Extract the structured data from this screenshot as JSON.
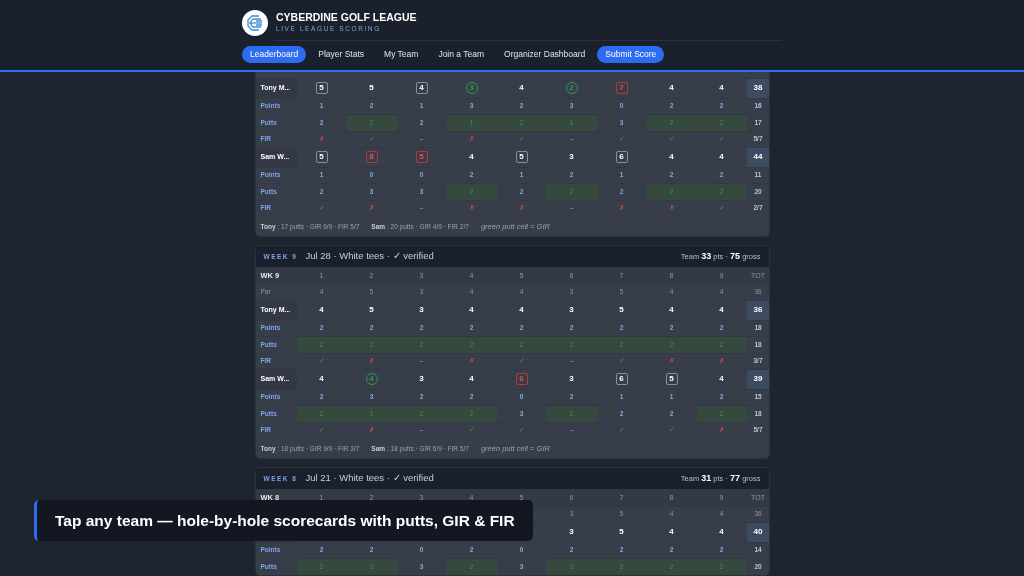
{
  "brand": {
    "title": "CYBERDINE GOLF LEAGUE",
    "subtitle": "LIVE LEAGUE SCORING"
  },
  "nav": [
    {
      "label": "Leaderboard",
      "kind": "tab",
      "selected": true
    },
    {
      "label": "Player Stats",
      "kind": "tab",
      "selected": false
    },
    {
      "label": "My Team",
      "kind": "tab",
      "selected": false
    },
    {
      "label": "Join a Team",
      "kind": "tab",
      "selected": false
    },
    {
      "label": "Organizer Dashboard",
      "kind": "tab",
      "selected": false
    },
    {
      "label": "Submit Score",
      "kind": "cta"
    }
  ],
  "cards": [
    {
      "players": [
        {
          "name": "Tony M...",
          "scores": [
            {
              "value": "5",
              "kind": "bogey"
            },
            {
              "value": "5",
              "kind": "par"
            },
            {
              "value": "4",
              "kind": "bogey"
            },
            {
              "value": "3",
              "kind": "birdie"
            },
            {
              "value": "4",
              "kind": "par"
            },
            {
              "value": "2",
              "kind": "birdie"
            },
            {
              "value": "7",
              "kind": "double"
            },
            {
              "value": "4",
              "kind": "par"
            },
            {
              "value": "4",
              "kind": "par"
            }
          ],
          "total": "38",
          "points_label": "Points",
          "points": [
            "1",
            "2",
            "1",
            "3",
            "2",
            "3",
            "0",
            "2",
            "2"
          ],
          "points_total": "16",
          "putts_label": "Putts",
          "putts": [
            {
              "value": "2",
              "gir": false
            },
            {
              "value": "2",
              "gir": true
            },
            {
              "value": "2",
              "gir": false
            },
            {
              "value": "1",
              "gir": true
            },
            {
              "value": "2",
              "gir": true
            },
            {
              "value": "1",
              "gir": true
            },
            {
              "value": "3",
              "gir": false
            },
            {
              "value": "2",
              "gir": true
            },
            {
              "value": "2",
              "gir": true
            }
          ],
          "putts_total": "17",
          "fir_label": "FIR",
          "fir": [
            {
              "text": "✗",
              "kind": "miss"
            },
            {
              "text": "✓",
              "kind": "hit"
            },
            {
              "text": "–",
              "kind": "na"
            },
            {
              "text": "✗",
              "kind": "miss"
            },
            {
              "text": "✓",
              "kind": "hit"
            },
            {
              "text": "–",
              "kind": "na"
            },
            {
              "text": "✓",
              "kind": "hit"
            },
            {
              "text": "✓",
              "kind": "hit"
            },
            {
              "text": "✓",
              "kind": "hit"
            }
          ],
          "fir_total": "5/7"
        },
        {
          "name": "Sam W...",
          "scores": [
            {
              "value": "5",
              "kind": "bogey"
            },
            {
              "value": "8",
              "kind": "double"
            },
            {
              "value": "5",
              "kind": "double"
            },
            {
              "value": "4",
              "kind": "par"
            },
            {
              "value": "5",
              "kind": "bogey"
            },
            {
              "value": "3",
              "kind": "par"
            },
            {
              "value": "6",
              "kind": "bogey"
            },
            {
              "value": "4",
              "kind": "par"
            },
            {
              "value": "4",
              "kind": "par"
            }
          ],
          "total": "44",
          "points_label": "Points",
          "points": [
            "1",
            "0",
            "0",
            "2",
            "1",
            "2",
            "1",
            "2",
            "2"
          ],
          "points_total": "11",
          "putts_label": "Putts",
          "putts": [
            {
              "value": "2",
              "gir": false
            },
            {
              "value": "3",
              "gir": false
            },
            {
              "value": "3",
              "gir": false
            },
            {
              "value": "2",
              "gir": true
            },
            {
              "value": "2",
              "gir": false
            },
            {
              "value": "2",
              "gir": true
            },
            {
              "value": "2",
              "gir": false
            },
            {
              "value": "2",
              "gir": true
            },
            {
              "value": "2",
              "gir": true
            }
          ],
          "putts_total": "20",
          "fir_label": "FIR",
          "fir": [
            {
              "text": "✓",
              "kind": "hit"
            },
            {
              "text": "✗",
              "kind": "miss"
            },
            {
              "text": "–",
              "kind": "na"
            },
            {
              "text": "✗",
              "kind": "miss"
            },
            {
              "text": "✗",
              "kind": "miss"
            },
            {
              "text": "–",
              "kind": "na"
            },
            {
              "text": "✗",
              "kind": "miss"
            },
            {
              "text": "✗",
              "kind": "miss"
            },
            {
              "text": "✓",
              "kind": "hit"
            }
          ],
          "fir_total": "2/7"
        }
      ],
      "summaries": [
        "**Tony** : 17 putts · GIR 6/9 · FIR 5/7",
        "**Sam** : 20 putts · GIR 4/9 · FIR 2/7"
      ],
      "note": "green putt cell = GIR"
    },
    {
      "week": "WEEK 9",
      "title": "Jul 28 · White tees · ✓ verified",
      "team": "Team **33** pts · **75** gross",
      "head": {
        "label": "WK 9",
        "holes": [
          "1",
          "2",
          "3",
          "4",
          "5",
          "6",
          "7",
          "8",
          "9"
        ],
        "total": "TOT"
      },
      "par": {
        "label": "Par",
        "values": [
          "4",
          "5",
          "3",
          "4",
          "4",
          "3",
          "5",
          "4",
          "4"
        ],
        "total": "36"
      },
      "players": [
        {
          "name": "Tony M...",
          "scores": [
            {
              "value": "4",
              "kind": "par"
            },
            {
              "value": "5",
              "kind": "par"
            },
            {
              "value": "3",
              "kind": "par"
            },
            {
              "value": "4",
              "kind": "par"
            },
            {
              "value": "4",
              "kind": "par"
            },
            {
              "value": "3",
              "kind": "par"
            },
            {
              "value": "5",
              "kind": "par"
            },
            {
              "value": "4",
              "kind": "par"
            },
            {
              "value": "4",
              "kind": "par"
            }
          ],
          "total": "36",
          "points_label": "Points",
          "points": [
            "2",
            "2",
            "2",
            "2",
            "2",
            "2",
            "2",
            "2",
            "2"
          ],
          "points_total": "18",
          "putts_label": "Putts",
          "putts": [
            {
              "value": "2",
              "gir": true
            },
            {
              "value": "2",
              "gir": true
            },
            {
              "value": "2",
              "gir": true
            },
            {
              "value": "2",
              "gir": true
            },
            {
              "value": "2",
              "gir": true
            },
            {
              "value": "2",
              "gir": true
            },
            {
              "value": "2",
              "gir": true
            },
            {
              "value": "2",
              "gir": true
            },
            {
              "value": "2",
              "gir": true
            }
          ],
          "putts_total": "18",
          "fir_label": "FIR",
          "fir": [
            {
              "text": "✓",
              "kind": "hit"
            },
            {
              "text": "✗",
              "kind": "miss"
            },
            {
              "text": "–",
              "kind": "na"
            },
            {
              "text": "✗",
              "kind": "miss"
            },
            {
              "text": "✓",
              "kind": "hit"
            },
            {
              "text": "–",
              "kind": "na"
            },
            {
              "text": "✓",
              "kind": "hit"
            },
            {
              "text": "✗",
              "kind": "miss"
            },
            {
              "text": "✗",
              "kind": "miss"
            }
          ],
          "fir_total": "3/7"
        },
        {
          "name": "Sam W...",
          "scores": [
            {
              "value": "4",
              "kind": "par"
            },
            {
              "value": "4",
              "kind": "birdie"
            },
            {
              "value": "3",
              "kind": "par"
            },
            {
              "value": "4",
              "kind": "par"
            },
            {
              "value": "6",
              "kind": "double"
            },
            {
              "value": "3",
              "kind": "par"
            },
            {
              "value": "6",
              "kind": "bogey"
            },
            {
              "value": "5",
              "kind": "bogey"
            },
            {
              "value": "4",
              "kind": "par"
            }
          ],
          "total": "39",
          "points_label": "Points",
          "points": [
            "2",
            "3",
            "2",
            "2",
            "0",
            "2",
            "1",
            "1",
            "2"
          ],
          "points_total": "15",
          "putts_label": "Putts",
          "putts": [
            {
              "value": "2",
              "gir": true
            },
            {
              "value": "1",
              "gir": true
            },
            {
              "value": "2",
              "gir": true
            },
            {
              "value": "2",
              "gir": true
            },
            {
              "value": "3",
              "gir": false
            },
            {
              "value": "2",
              "gir": true
            },
            {
              "value": "2",
              "gir": false
            },
            {
              "value": "2",
              "gir": false
            },
            {
              "value": "2",
              "gir": true
            }
          ],
          "putts_total": "18",
          "fir_label": "FIR",
          "fir": [
            {
              "text": "✓",
              "kind": "hit"
            },
            {
              "text": "✗",
              "kind": "miss"
            },
            {
              "text": "–",
              "kind": "na"
            },
            {
              "text": "✓",
              "kind": "hit"
            },
            {
              "text": "✓",
              "kind": "hit"
            },
            {
              "text": "–",
              "kind": "na"
            },
            {
              "text": "✓",
              "kind": "hit"
            },
            {
              "text": "✓",
              "kind": "hit"
            },
            {
              "text": "✗",
              "kind": "miss"
            }
          ],
          "fir_total": "5/7"
        }
      ],
      "summaries": [
        "**Tony** : 18 putts · GIR 9/9 · FIR 3/7",
        "**Sam** : 18 putts · GIR 6/9 · FIR 5/7"
      ],
      "note": "green putt cell = GIR"
    },
    {
      "week": "WEEK 8",
      "title": "Jul 21 · White tees · ✓ verified",
      "team": "Team **31** pts · **77** gross",
      "head": {
        "label": "WK 8",
        "holes": [
          "1",
          "2",
          "3",
          "4",
          "5",
          "6",
          "7",
          "8",
          "9"
        ],
        "total": "TOT"
      },
      "par": {
        "values": [
          "3",
          "5",
          "4",
          "4"
        ],
        "total": "36"
      },
      "players": [
        {
          "scores": [
            {
              "value": "3",
              "kind": "par"
            },
            {
              "value": "5",
              "kind": "par"
            },
            {
              "value": "4",
              "kind": "par"
            },
            {
              "value": "4",
              "kind": "par"
            }
          ],
          "total": "40",
          "points_label": "Points",
          "points": [
            "2",
            "2",
            "0",
            "2",
            "0",
            "2",
            "2",
            "2",
            "2"
          ],
          "points_total": "14",
          "putts_label": "Putts",
          "putts": [
            {
              "value": "2",
              "gir": true
            },
            {
              "value": "2",
              "gir": true
            },
            {
              "value": "3",
              "gir": false
            },
            {
              "value": "2",
              "gir": true
            },
            {
              "value": "3",
              "gir": false
            },
            {
              "value": "2",
              "gir": true
            },
            {
              "value": "2",
              "gir": true
            },
            {
              "value": "2",
              "gir": true
            },
            {
              "value": "2",
              "gir": true
            }
          ],
          "putts_total": "20"
        }
      ]
    }
  ],
  "toast": "Tap any team — hole-by-hole scorecards with putts, GIR & FIR"
}
